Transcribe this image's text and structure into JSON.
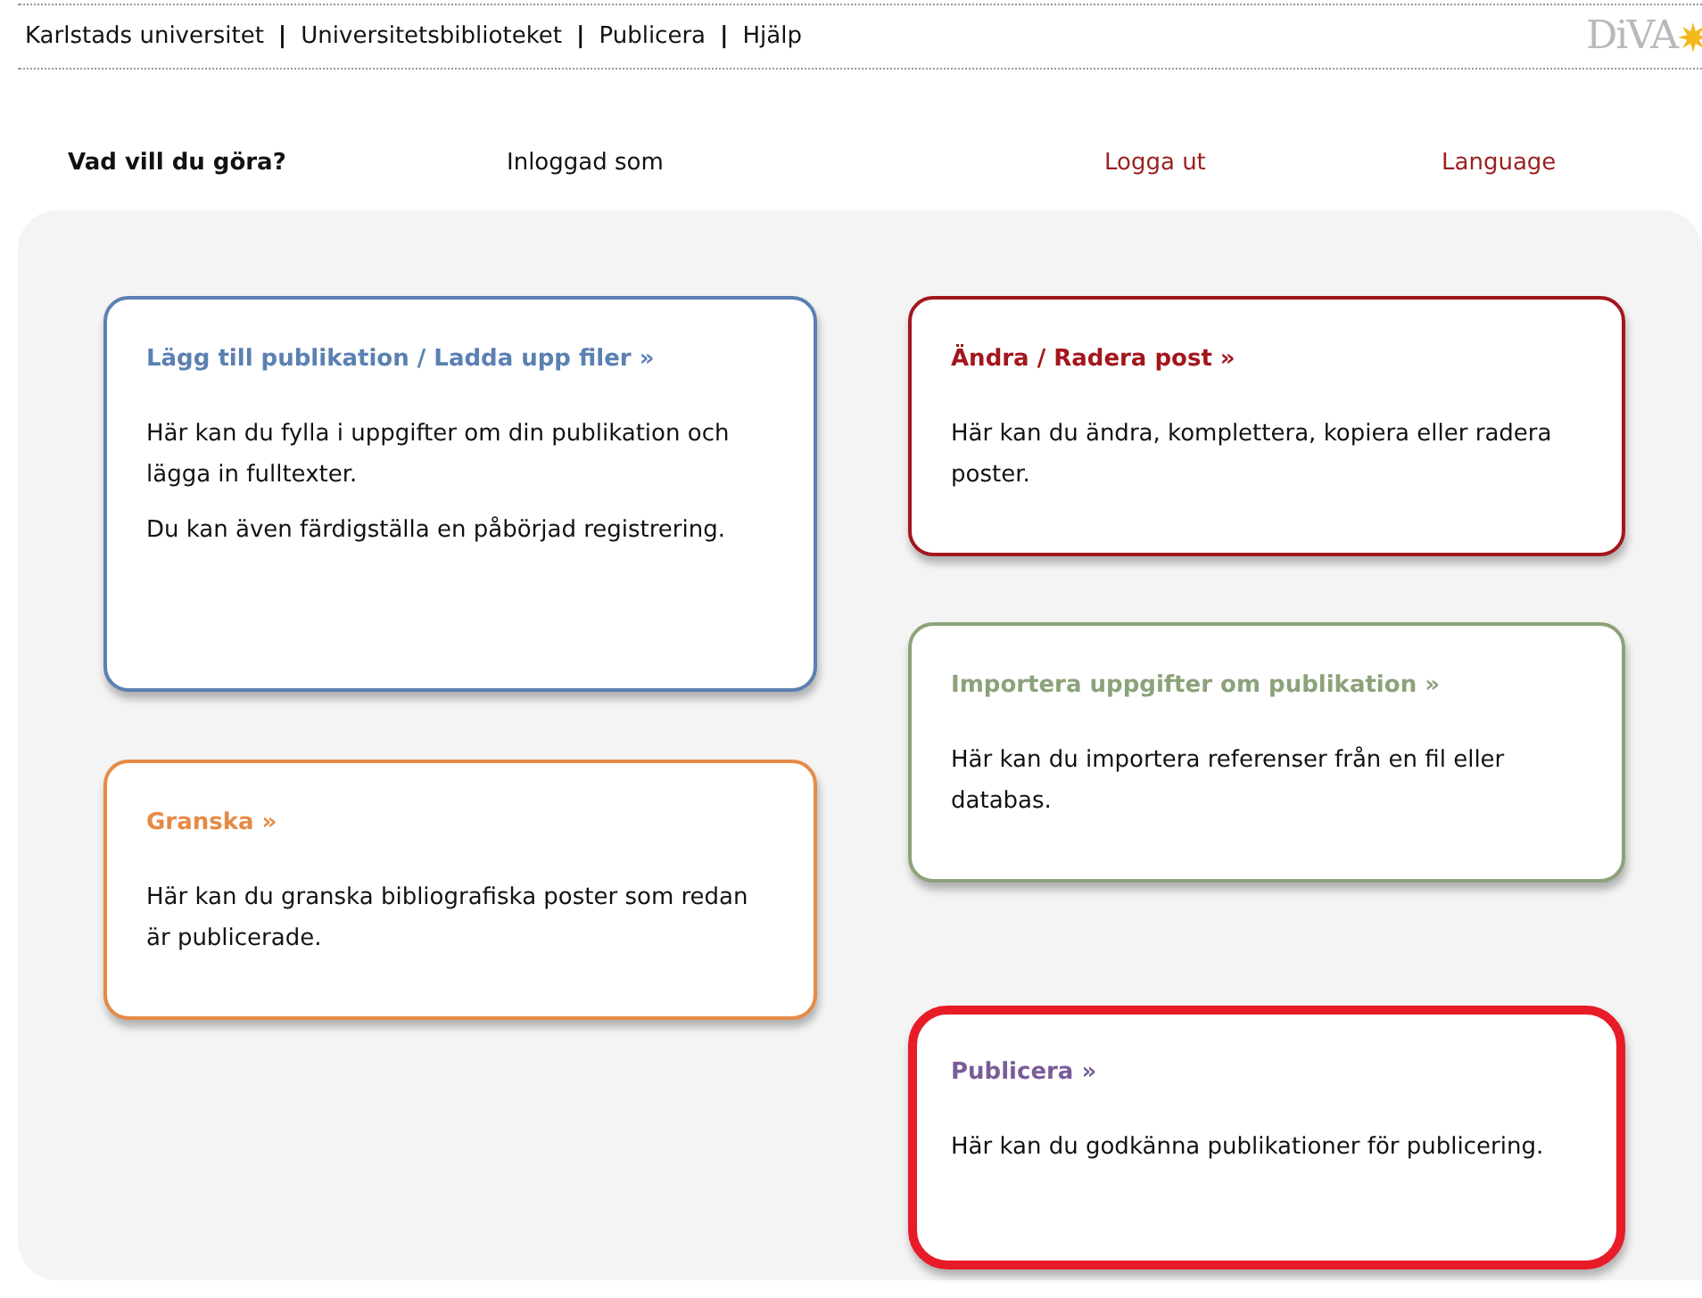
{
  "top_nav": [
    {
      "kind": "link",
      "text": "Karlstads universitet"
    },
    {
      "kind": "separator",
      "text": "|"
    },
    {
      "kind": "link",
      "text": "Universitetsbiblioteket"
    },
    {
      "kind": "separator",
      "text": "|"
    },
    {
      "kind": "link",
      "text": "Publicera"
    },
    {
      "kind": "separator",
      "text": "|"
    },
    {
      "kind": "link",
      "text": "Hjälp"
    }
  ],
  "logo": {
    "text": "DiVA"
  },
  "toolbar": {
    "heading": "Vad vill du göra?",
    "logged_in": "Inloggad som",
    "logout": "Logga ut",
    "language": "Language"
  },
  "columns": [
    [
      {
        "title": "Lägg till publikation / Ladda upp filer »",
        "color": "#5b80b2",
        "paragraphs": [
          "Här kan du fylla i uppgifter om din publikation och lägga in fulltexter.",
          "Du kan även färdigställa en påbörjad registrering."
        ],
        "highlighted": false
      },
      {
        "title": "Granska »",
        "color": "#e68a45",
        "paragraphs": [
          "Här kan du granska bibliografiska poster som redan är publicerade."
        ],
        "highlighted": false
      }
    ],
    [
      {
        "title": "Ändra / Radera post »",
        "color": "#a3161c",
        "paragraphs": [
          "Här kan du ändra, komplettera, kopiera eller radera poster."
        ],
        "highlighted": false
      },
      {
        "title": "Importera uppgifter om publikation »",
        "color": "#8ca27a",
        "paragraphs": [
          "Här kan du importera referenser från en fil eller databas."
        ],
        "highlighted": false
      },
      {
        "title": "Publicera »",
        "color": "#7a5c98",
        "paragraphs": [
          "Här kan du godkänna publikationer för publicering."
        ],
        "highlighted": true
      }
    ]
  ]
}
